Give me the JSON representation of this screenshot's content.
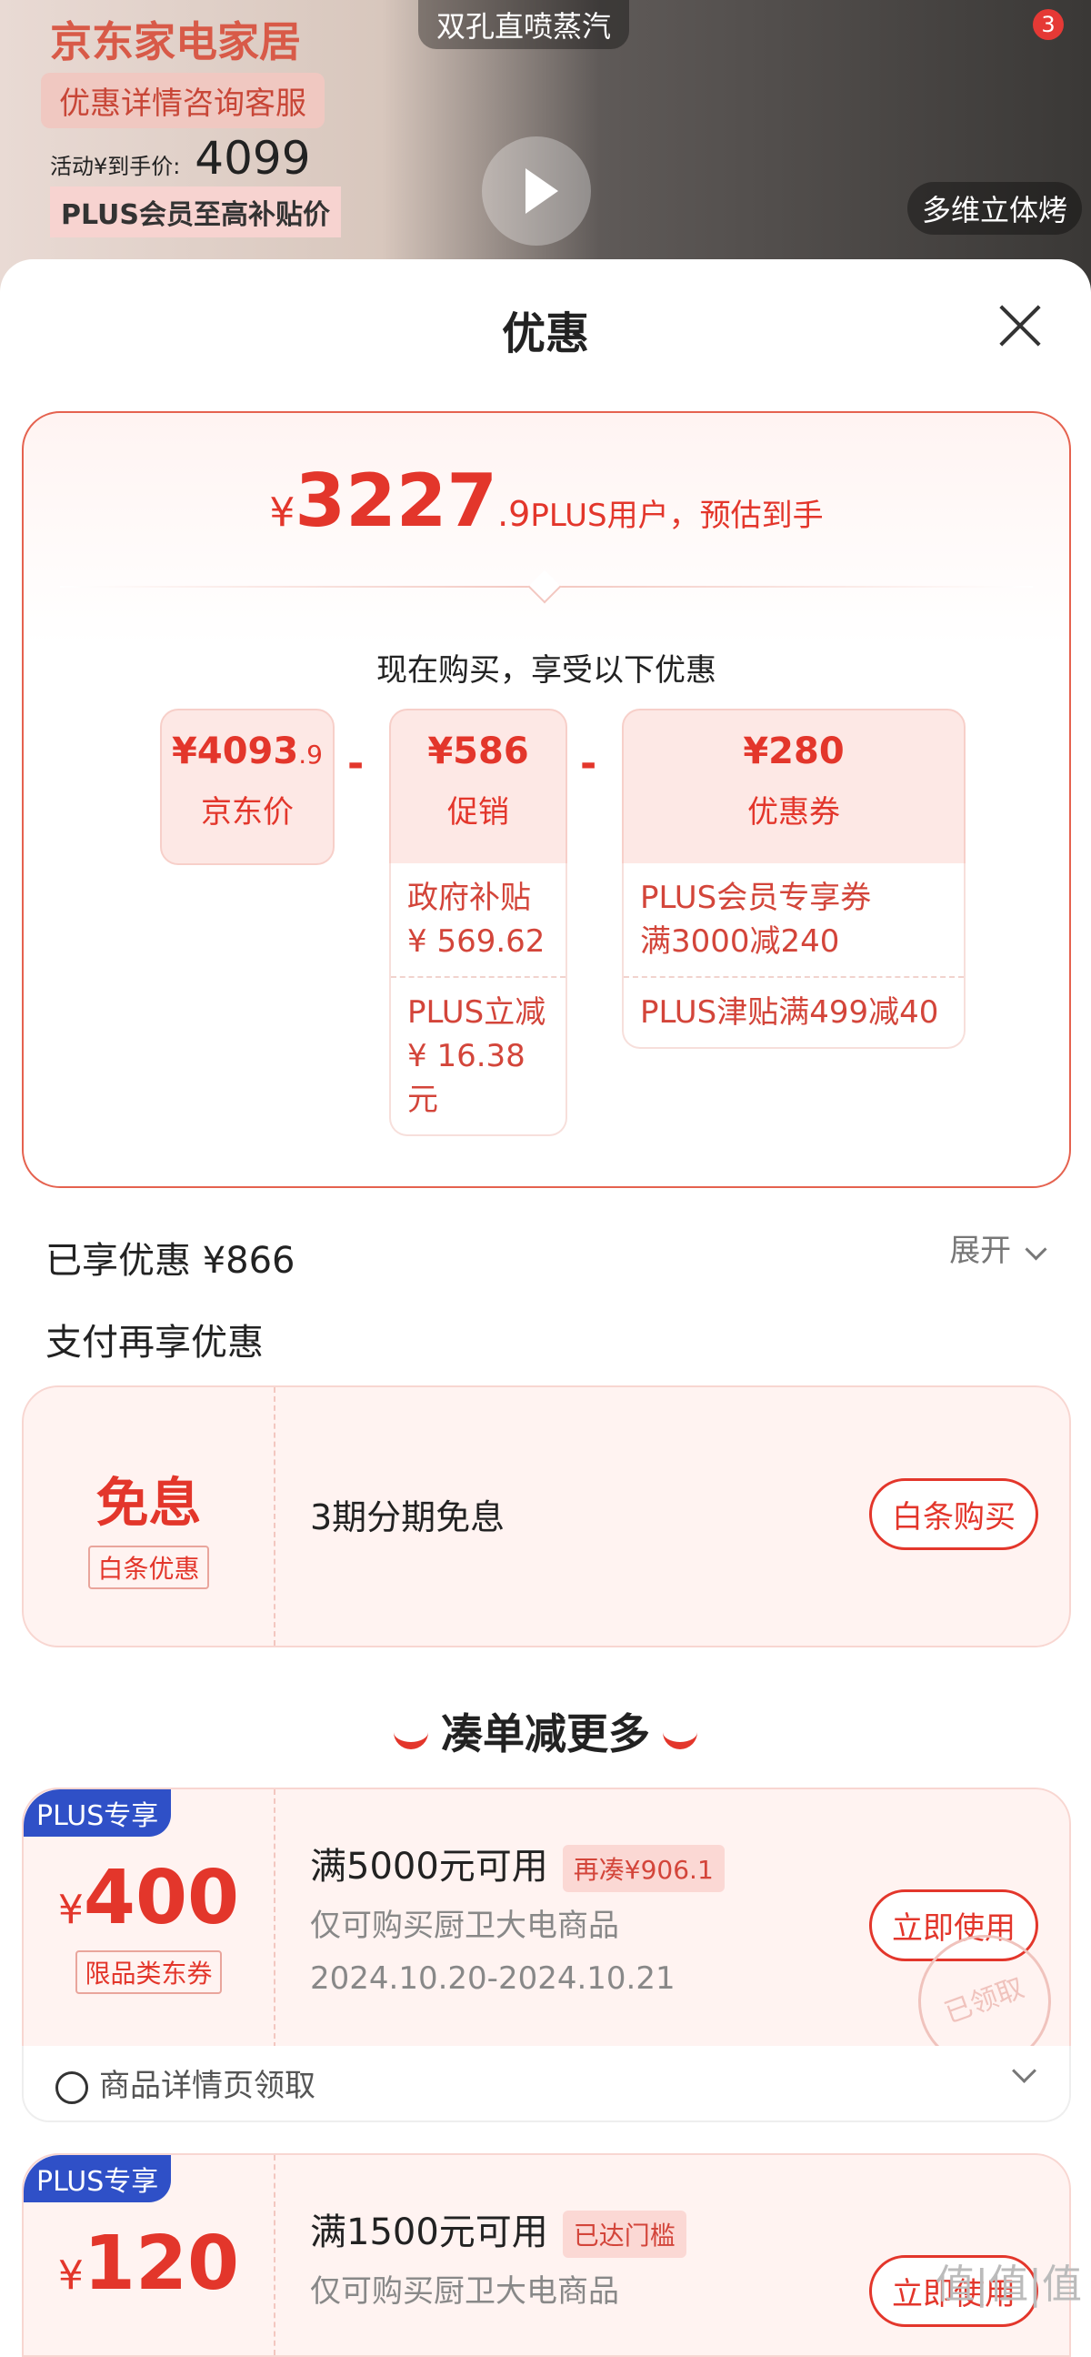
{
  "background": {
    "brand": "京东家电家居",
    "chip": "优惠详情咨询客服",
    "act_price_label": "活动¥到手价:",
    "act_price": "4099",
    "plus_note": "PLUS会员至高补贴价",
    "steam_label": "双孔直喷蒸汽",
    "multi_label": "多维立体烤",
    "badge": "3"
  },
  "sheet": {
    "title": "优惠"
  },
  "estimate": {
    "currency": "¥",
    "integer": "3227",
    "decimal": ".9",
    "desc": "PLUS用户，预估到手"
  },
  "buy_now": "现在购买，享受以下优惠",
  "breakdown": {
    "jd": {
      "currency": "¥",
      "amount": "4093",
      "decimal": ".9",
      "label": "京东价"
    },
    "promo": {
      "amount": "¥586",
      "label": "促销",
      "items": [
        "政府补贴\n¥ 569.62",
        "PLUS立减\n¥ 16.38元"
      ]
    },
    "coupon": {
      "amount": "¥280",
      "label": "优惠券",
      "items": [
        "PLUS会员专享券\n满3000减240",
        "PLUS津贴满499减40"
      ]
    },
    "op": "-"
  },
  "enjoyed": "已享优惠 ¥866",
  "expand": "展开",
  "pay_again": "支付再享优惠",
  "installment": {
    "big": "免息",
    "tag": "白条优惠",
    "text": "3期分期免息",
    "button": "白条购买"
  },
  "more_title": "凑单减更多",
  "coupons": [
    {
      "plus": "PLUS专享",
      "currency": "¥",
      "amount": "400",
      "tag": "限品类东券",
      "condition": "满5000元可用",
      "pill": "再凑¥906.1",
      "scope": "仅可购买厨卫大电商品",
      "date": "2024.10.20-2024.10.21",
      "button": "立即使用",
      "stamp": "已领取",
      "source": "商品详情页领取"
    },
    {
      "plus": "PLUS专享",
      "currency": "¥",
      "amount": "120",
      "condition": "满1500元可用",
      "pill": "已达门槛",
      "scope": "仅可购买厨卫大电商品",
      "button": "立即使用"
    }
  ],
  "watermark": "值|值|值"
}
